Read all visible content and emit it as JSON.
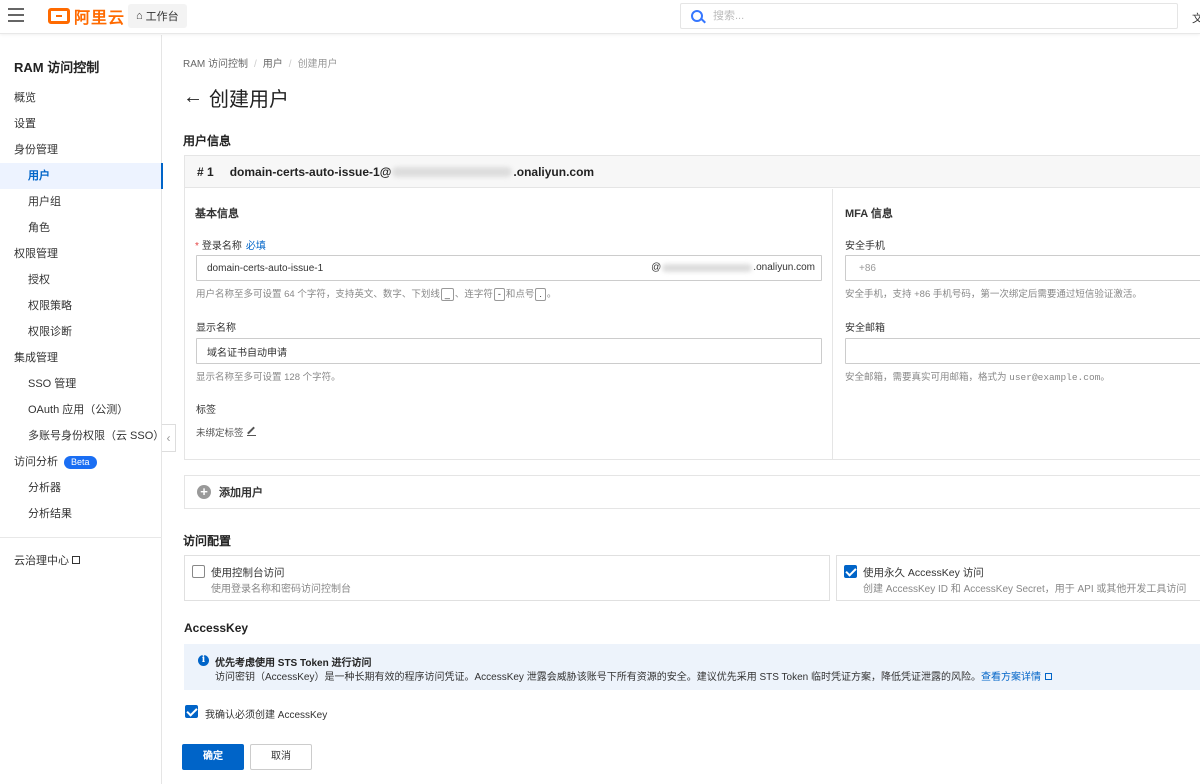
{
  "topbar": {
    "logo_text": "阿里云",
    "workbench_label": "工作台",
    "search_placeholder": "搜索...",
    "right_cut_text": "文"
  },
  "sidebar": {
    "title": "RAM 访问控制",
    "items": [
      {
        "label": "概览"
      },
      {
        "label": "设置"
      },
      {
        "label": "身份管理"
      },
      {
        "label": "用户"
      },
      {
        "label": "用户组"
      },
      {
        "label": "角色"
      },
      {
        "label": "权限管理"
      },
      {
        "label": "授权"
      },
      {
        "label": "权限策略"
      },
      {
        "label": "权限诊断"
      },
      {
        "label": "集成管理"
      },
      {
        "label": "SSO 管理"
      },
      {
        "label": "OAuth 应用（公测）"
      },
      {
        "label": "多账号身份权限（云 SSO）"
      },
      {
        "label": "访问分析"
      },
      {
        "label": "分析器"
      },
      {
        "label": "分析结果"
      }
    ],
    "beta_badge": "Beta",
    "governance_label": "云治理中心"
  },
  "breadcrumb": [
    "RAM 访问控制",
    "用户",
    "创建用户"
  ],
  "page_title": "创建用户",
  "user_info": {
    "section_title": "用户信息",
    "card_number": "# 1",
    "card_account_prefix": "domain-certs-auto-issue-1@",
    "card_account_suffix": ".onaliyun.com",
    "basic_title": "基本信息",
    "login_name_label": "登录名称",
    "login_name_required_mark": "*",
    "login_name_must": "必填",
    "login_name_value": "domain-certs-auto-issue-1",
    "login_domain_at": "@",
    "login_domain_suffix": ".onaliyun.com",
    "login_hint_1": "用户名称至多可设置 64 个字符，支持英文、数字、下划线",
    "login_hint_underscore": "_",
    "login_hint_2": "、连字符",
    "login_hint_hyphen": "-",
    "login_hint_3": "和点号",
    "login_hint_dot": ".",
    "login_hint_4": "。",
    "display_name_label": "显示名称",
    "display_name_value": "域名证书自动申请",
    "display_hint": "显示名称至多可设置 128 个字符。",
    "tag_label": "标签",
    "tag_value": "未绑定标签",
    "mfa_title": "MFA 信息",
    "phone_label": "安全手机",
    "phone_placeholder": "+86",
    "phone_hint": "安全手机，支持 +86 手机号码，第一次绑定后需要通过短信验证激活。",
    "email_label": "安全邮箱",
    "email_value": "",
    "email_hint_prefix": "安全邮箱，需要真实可用邮箱，格式为 ",
    "email_hint_example": "user@example.com",
    "email_hint_suffix": "。"
  },
  "add_user_label": "添加用户",
  "access_config": {
    "section_title": "访问配置",
    "console": {
      "title": "使用控制台访问",
      "desc": "使用登录名称和密码访问控制台",
      "checked": false
    },
    "accesskey": {
      "title": "使用永久 AccessKey 访问",
      "desc": "创建 AccessKey ID 和 AccessKey Secret，用于 API 或其他开发工具访问",
      "checked": true
    }
  },
  "accesskey_section": {
    "title": "AccessKey",
    "notice_title": "优先考虑使用 STS Token 进行访问",
    "notice_text": "访问密钥（AccessKey）是一种长期有效的程序访问凭证。AccessKey 泄露会威胁该账号下所有资源的安全。建议优先采用 STS Token 临时凭证方案，降低凭证泄露的风险。",
    "notice_link": "查看方案详情",
    "confirm_label": "我确认必须创建 AccessKey",
    "confirm_checked": true
  },
  "buttons": {
    "ok": "确定",
    "cancel": "取消"
  },
  "colors": {
    "brand": "#ff6a00",
    "primary": "#0064c8",
    "beta": "#1a6ef3"
  }
}
